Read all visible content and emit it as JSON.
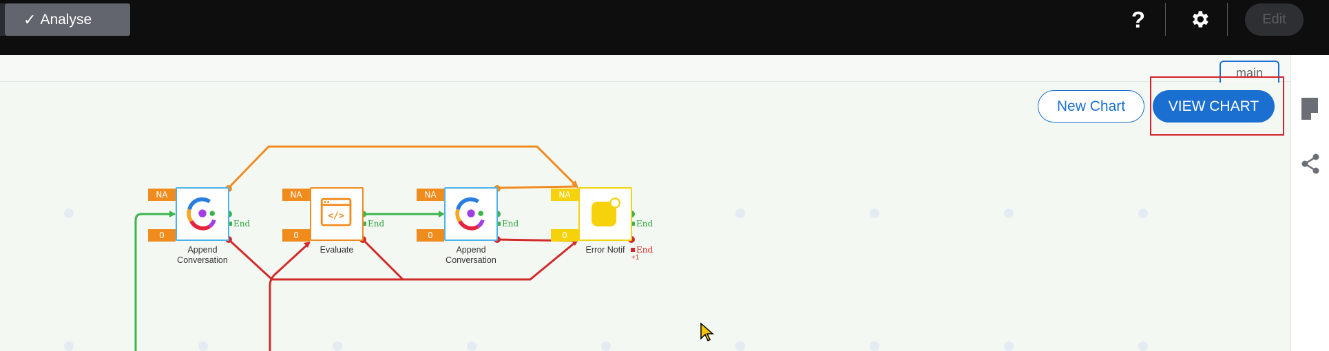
{
  "topbar": {
    "analyse_label": "Analyse",
    "help_label": "?",
    "edit_label": "Edit"
  },
  "branch": {
    "label": "main"
  },
  "toolbar": {
    "new_chart_label": "New Chart",
    "view_chart_label": "VIEW CHART"
  },
  "colors": {
    "accent": "#1a6fd0",
    "highlight": "#d3212d",
    "success": "#2ea33e",
    "error": "#d22a2a",
    "warning": "#f08b1d"
  },
  "flow": {
    "nodes": [
      {
        "name": "append-conversation-1",
        "icon": "conversation-icon",
        "label_line1": "Append",
        "label_line2": "Conversation",
        "badge_top": "NA",
        "badge_bottom": "0",
        "end_label": "End"
      },
      {
        "name": "evaluate",
        "icon": "code-icon",
        "label_line1": "Evaluate",
        "label_line2": "",
        "badge_top": "NA",
        "badge_bottom": "0",
        "end_label": "End"
      },
      {
        "name": "append-conversation-2",
        "icon": "conversation-icon",
        "label_line1": "Append",
        "label_line2": "Conversation",
        "badge_top": "NA",
        "badge_bottom": "0",
        "end_label": "End"
      },
      {
        "name": "error-notif",
        "icon": "notification-icon",
        "label_line1": "Error Notif",
        "label_line2": "",
        "badge_top": "NA",
        "badge_bottom": "0",
        "end_label": "End",
        "error_end_label": "End",
        "error_count": "+1"
      }
    ]
  }
}
